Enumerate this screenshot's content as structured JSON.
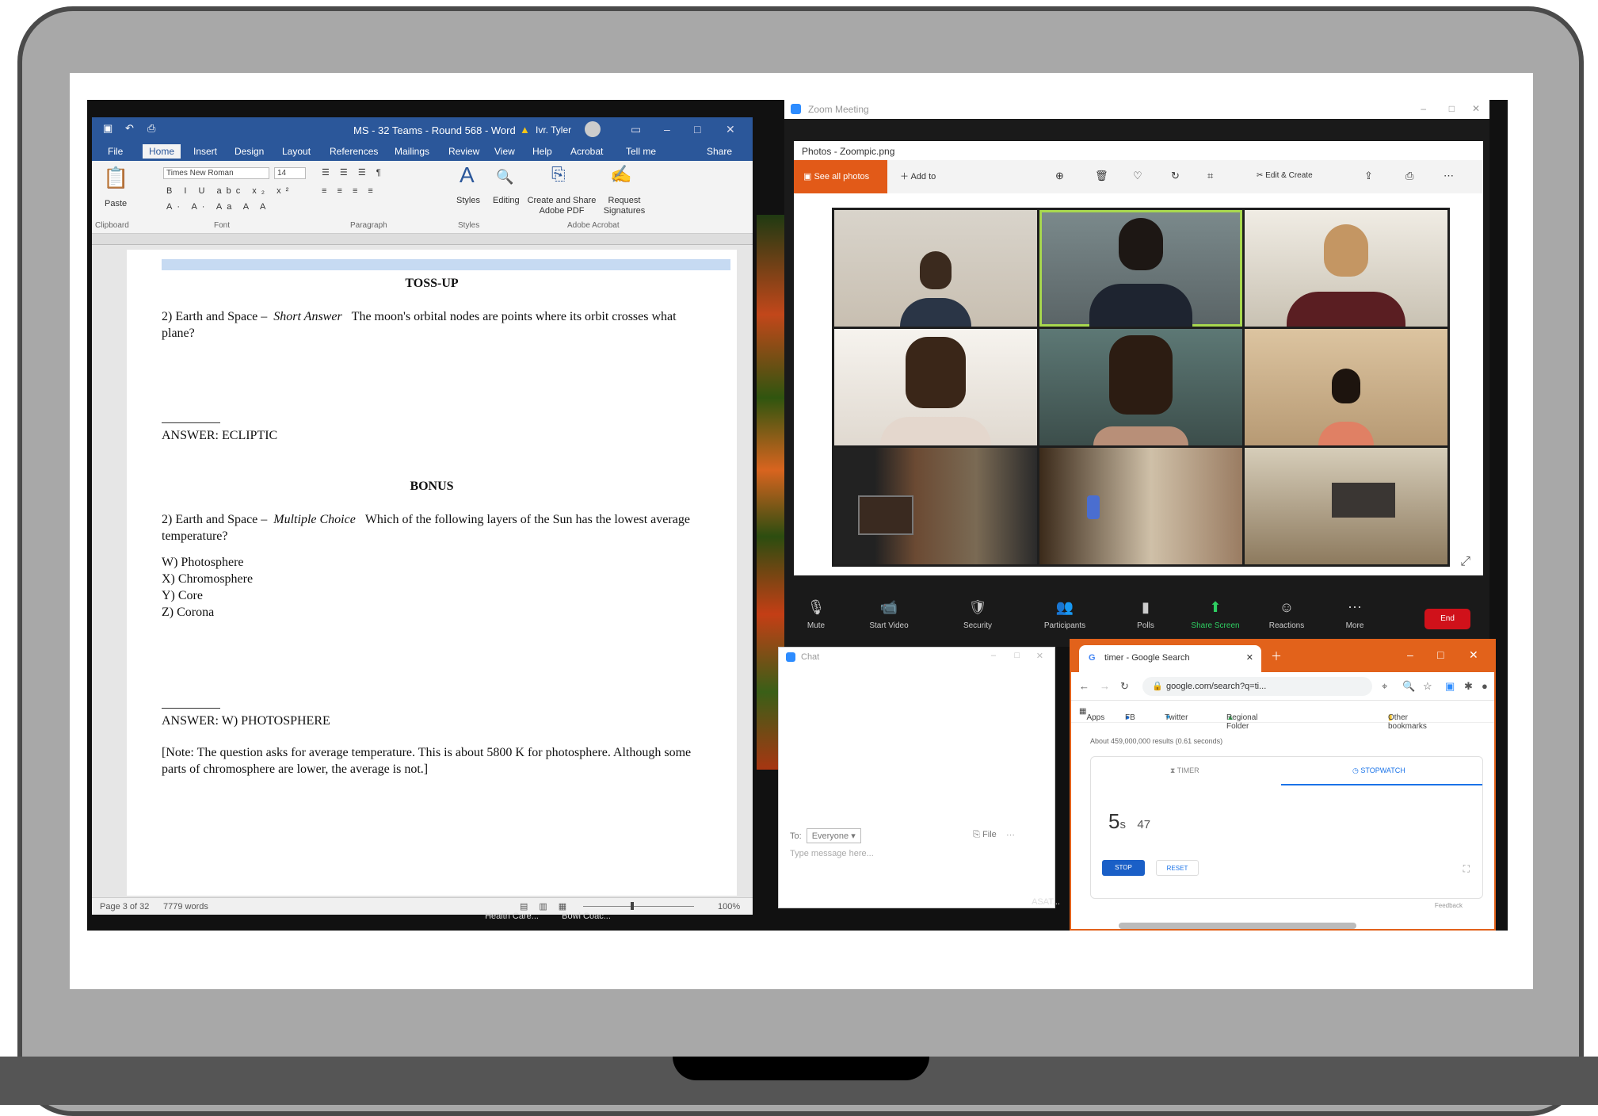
{
  "word": {
    "title": "MS - 32 Teams - Round 568 - Word",
    "user": "Ivr. Tyler",
    "tabs": [
      "File",
      "Home",
      "Insert",
      "Design",
      "Layout",
      "References",
      "Mailings",
      "Review",
      "View",
      "Help",
      "Acrobat",
      "Tell me",
      "Share"
    ],
    "ribbon": {
      "paste": "Paste",
      "font_name": "Times New Roman",
      "font_size": "14",
      "styles": "Styles",
      "editing": "Editing",
      "create_share": "Create and Share Adobe PDF",
      "request_sig": "Request Signatures",
      "groups": [
        "Clipboard",
        "Font",
        "Paragraph",
        "Styles",
        "Adobe Acrobat"
      ]
    },
    "doc": {
      "tossup": "TOSS-UP",
      "q1_prefix": "2) Earth and Space –",
      "q1_type": "Short Answer",
      "q1_text": "The moon's orbital nodes are points where its orbit crosses what plane?",
      "a1": "ANSWER: ECLIPTIC",
      "bonus": "BONUS",
      "q2_prefix": "2) Earth and Space –",
      "q2_type": "Multiple Choice",
      "q2_text": "Which of the following layers of the Sun has the lowest average temperature?",
      "options": [
        "W) Photosphere",
        "X) Chromosphere",
        "Y) Core",
        "Z) Corona"
      ],
      "a2": "ANSWER: W) PHOTOSPHERE",
      "note": "[Note: The question asks for average temperature. This is about 5800 K for photosphere. Although some parts of chromosphere are lower, the average is not.]"
    },
    "status": {
      "page": "Page 3 of 32",
      "words": "7779 words",
      "zoom": "100%"
    }
  },
  "zoom": {
    "title": "Zoom Meeting",
    "photos_title": "Photos - Zoompic.png",
    "see_all": "See all photos",
    "add_to": "Add to",
    "edit_create": "Edit & Create",
    "controls": [
      "Mute",
      "Start Video",
      "Security",
      "Participants",
      "Polls",
      "Share Screen",
      "Reactions",
      "More"
    ],
    "end": "End"
  },
  "chat": {
    "title": "Chat",
    "to_label": "To:",
    "to_value": "Everyone",
    "file": "File",
    "placeholder": "Type message here..."
  },
  "chrome": {
    "tab_title": "timer - Google Search",
    "url": "google.com/search?q=ti...",
    "bookmarks": [
      "Apps",
      "FB",
      "Twitter",
      "Regional Folder",
      "Other bookmarks"
    ],
    "results": "About 459,000,000 results (0.61 seconds)",
    "timer_tab": "TIMER",
    "stopwatch_tab": "STOPWATCH",
    "value_main": "5",
    "value_unit": "s",
    "value_ms": "47",
    "stop": "STOP",
    "reset": "RESET",
    "feedback": "Feedback"
  },
  "desktop": {
    "icons": [
      "Health Care...",
      "Bowl Coac...",
      "ASAT..."
    ]
  }
}
